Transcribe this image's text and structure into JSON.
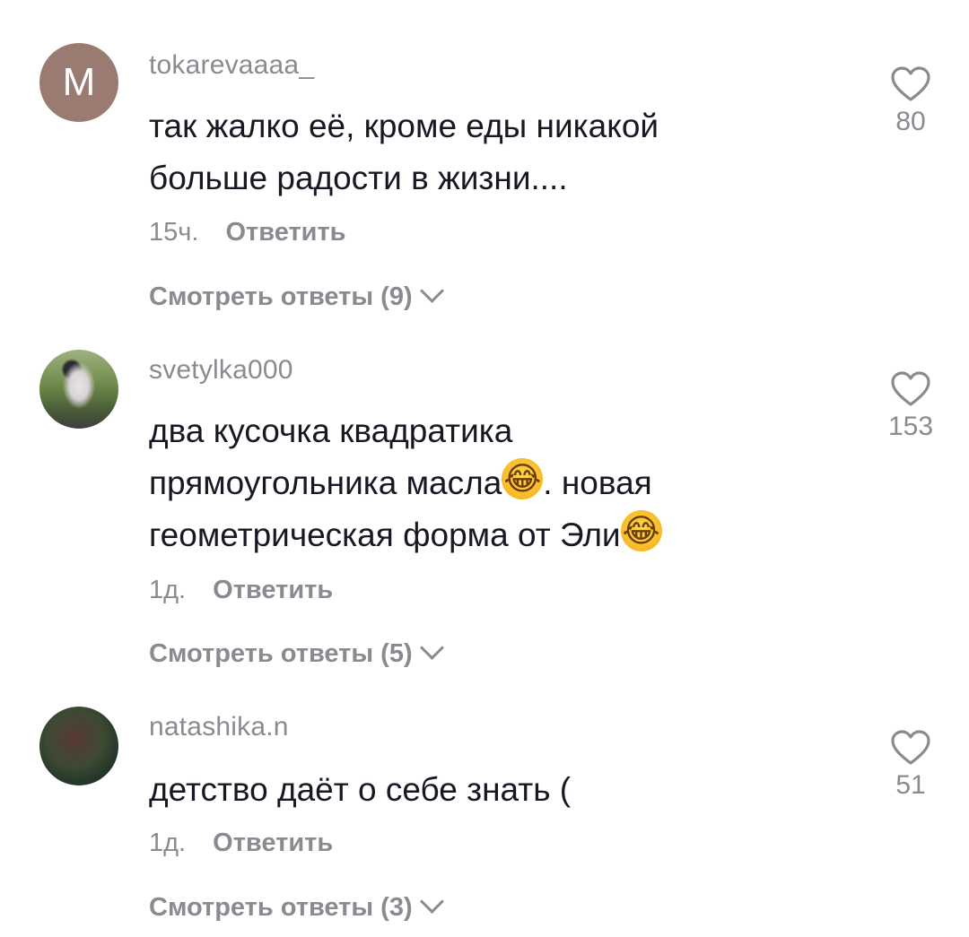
{
  "comments": [
    {
      "avatar_letter": "M",
      "username": "tokarevaaaa_",
      "text_lines": [
        "так жалко её, кроме еды никакой",
        "больше радости в жизни...."
      ],
      "time": "15ч.",
      "reply_label": "Ответить",
      "view_replies": "Смотреть ответы (9)",
      "likes": "80"
    },
    {
      "username": "svetylka000",
      "text_lines": [
        "два кусочка квадратика",
        "прямоугольника масла",
        ". новая",
        "геометрическая форма от Эли"
      ],
      "emoji": "😂",
      "time": "1д.",
      "reply_label": "Ответить",
      "view_replies": "Смотреть ответы (5)",
      "likes": "153"
    },
    {
      "username": "natashika.n",
      "text_lines": [
        "детство даёт о себе знать ("
      ],
      "time": "1д.",
      "reply_label": "Ответить",
      "view_replies": "Смотреть ответы (3)",
      "likes": "51"
    }
  ],
  "icons": {
    "like": "heart-outline-icon",
    "expand": "chevron-down-icon"
  },
  "colors": {
    "text": "#161823",
    "muted": "#8a8b91",
    "avatar_letter_bg": "#9a7b72"
  }
}
